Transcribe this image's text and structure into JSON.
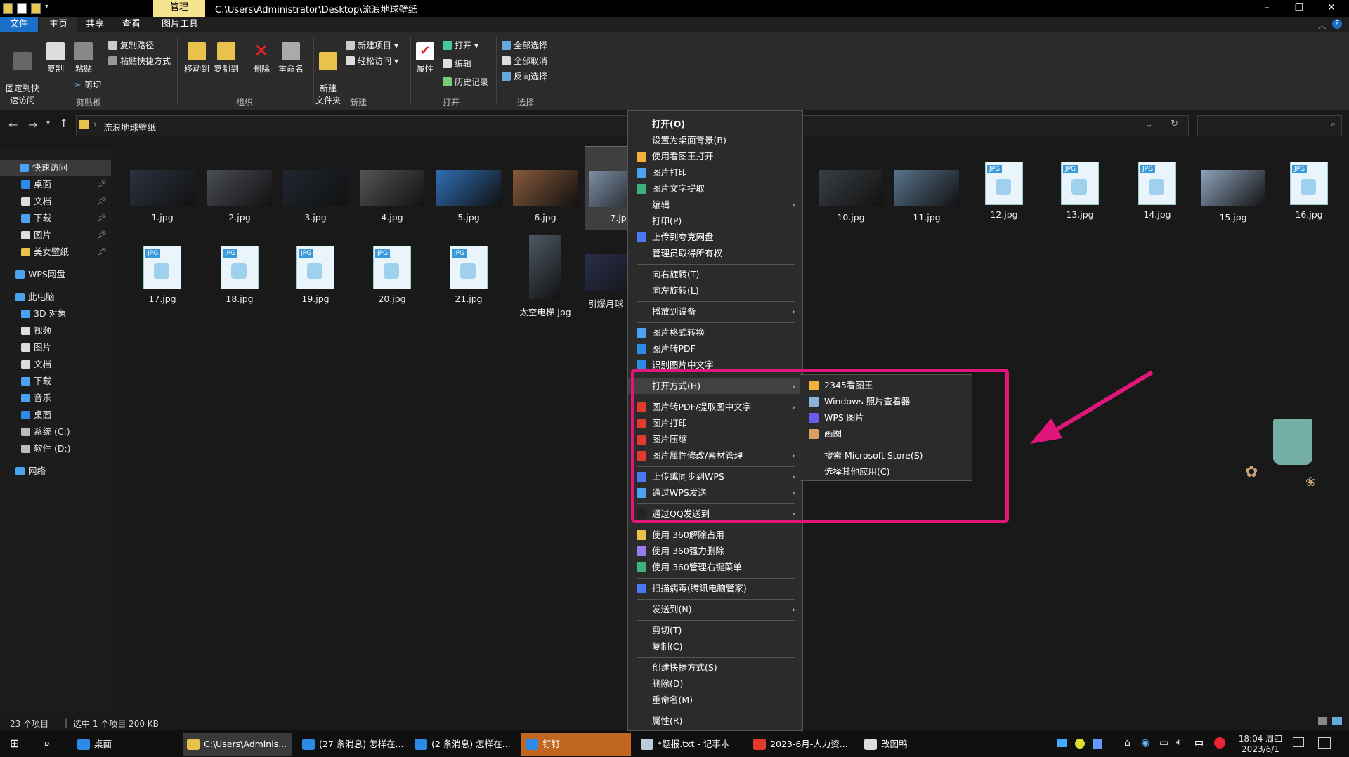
{
  "window": {
    "title_path": "C:\\Users\\Administrator\\Desktop\\流浪地球壁纸",
    "context_tab": "管理"
  },
  "ribbon_tabs": [
    "文件",
    "主页",
    "共享",
    "查看",
    "图片工具"
  ],
  "ribbon": {
    "pin_label": "固定到快\n速访问",
    "copy_label": "复制",
    "paste_label": "粘贴",
    "copy_path_label": "复制路径",
    "paste_shortcut_label": "粘贴快捷方式",
    "cut_label": "剪切",
    "move_to_label": "移动到",
    "copy_to_label": "复制到",
    "delete_label": "删除",
    "rename_label": "重命名",
    "new_folder_label": "新建\n文件夹",
    "new_item_label": "新建项目",
    "easy_access_label": "轻松访问",
    "properties_label": "属性",
    "open_label": "打开",
    "edit_label": "编辑",
    "history_label": "历史记录",
    "select_all_label": "全部选择",
    "select_none_label": "全部取消",
    "invert_label": "反向选择",
    "groups": {
      "clipboard": "剪贴板",
      "organize": "组织",
      "new": "新建",
      "open": "打开",
      "select": "选择"
    }
  },
  "address": {
    "folder": "流浪地球壁纸"
  },
  "sidebar": {
    "items": [
      {
        "label": "快速访问",
        "icon": "star-icon"
      },
      {
        "label": "桌面",
        "icon": "desktop-icon",
        "pinned": true
      },
      {
        "label": "文档",
        "icon": "document-icon",
        "pinned": true
      },
      {
        "label": "下载",
        "icon": "download-icon",
        "pinned": true
      },
      {
        "label": "图片",
        "icon": "picture-icon",
        "pinned": true
      },
      {
        "label": "美女壁纸",
        "icon": "folder-icon",
        "pinned": true
      },
      {
        "label": "WPS网盘",
        "icon": "cloud-icon"
      },
      {
        "label": "此电脑",
        "icon": "computer-icon"
      },
      {
        "label": "3D 对象",
        "icon": "cube-icon"
      },
      {
        "label": "视频",
        "icon": "video-icon"
      },
      {
        "label": "图片",
        "icon": "picture-icon"
      },
      {
        "label": "文档",
        "icon": "document-icon"
      },
      {
        "label": "下载",
        "icon": "download-icon"
      },
      {
        "label": "音乐",
        "icon": "music-icon"
      },
      {
        "label": "桌面",
        "icon": "desktop-icon"
      },
      {
        "label": "系统 (C:)",
        "icon": "drive-icon"
      },
      {
        "label": "软件 (D:)",
        "icon": "drive-icon"
      },
      {
        "label": "网络",
        "icon": "network-icon"
      }
    ]
  },
  "files": [
    {
      "name": "1.jpg",
      "kind": "photo"
    },
    {
      "name": "2.jpg",
      "kind": "photo"
    },
    {
      "name": "3.jpg",
      "kind": "photo"
    },
    {
      "name": "4.jpg",
      "kind": "photo"
    },
    {
      "name": "5.jpg",
      "kind": "photo"
    },
    {
      "name": "6.jpg",
      "kind": "photo"
    },
    {
      "name": "7.jpg",
      "kind": "photo",
      "selected": true
    },
    {
      "name": "10.jpg",
      "kind": "photo"
    },
    {
      "name": "11.jpg",
      "kind": "photo"
    },
    {
      "name": "12.jpg",
      "kind": "jpg"
    },
    {
      "name": "13.jpg",
      "kind": "jpg"
    },
    {
      "name": "14.jpg",
      "kind": "jpg"
    },
    {
      "name": "15.jpg",
      "kind": "photo"
    },
    {
      "name": "16.jpg",
      "kind": "jpg"
    },
    {
      "name": "17.jpg",
      "kind": "jpg"
    },
    {
      "name": "18.jpg",
      "kind": "jpg"
    },
    {
      "name": "19.jpg",
      "kind": "jpg"
    },
    {
      "name": "20.jpg",
      "kind": "jpg"
    },
    {
      "name": "21.jpg",
      "kind": "jpg"
    },
    {
      "name": "太空电梯.jpg",
      "kind": "photo"
    },
    {
      "name": "引爆月球",
      "kind": "photo"
    }
  ],
  "context_menu": {
    "items": [
      {
        "label": "打开(O)",
        "bold": true
      },
      {
        "label": "设置为桌面背景(B)"
      },
      {
        "label": "使用看图王打开",
        "icon": "image-viewer-icon"
      },
      {
        "label": "图片打印",
        "icon": "print-icon"
      },
      {
        "label": "图片文字提取",
        "icon": "ocr-icon"
      },
      {
        "label": "编辑",
        "arrow": true
      },
      {
        "label": "打印(P)"
      },
      {
        "label": "上传到夸克网盘",
        "icon": "quark-icon"
      },
      {
        "label": "管理员取得所有权"
      },
      {
        "sep": true
      },
      {
        "label": "向右旋转(T)"
      },
      {
        "label": "向左旋转(L)"
      },
      {
        "sep": true
      },
      {
        "label": "播放到设备",
        "arrow": true
      },
      {
        "sep": true
      },
      {
        "label": "图片格式转换",
        "icon": "convert-icon"
      },
      {
        "label": "图片转PDF",
        "icon": "pdf-icon"
      },
      {
        "label": "识别图片中文字",
        "icon": "text-recognize-icon"
      },
      {
        "sep": true
      },
      {
        "label": "打开方式(H)",
        "arrow": true,
        "highlight": true
      },
      {
        "sep": true
      },
      {
        "label": "图片转PDF/提取图中文字",
        "icon": "wps-icon",
        "arrow": true
      },
      {
        "label": "图片打印",
        "icon": "wps-icon"
      },
      {
        "label": "图片压缩",
        "icon": "wps-icon"
      },
      {
        "label": "图片属性修改/素材管理",
        "icon": "wps-icon",
        "arrow": true
      },
      {
        "sep": true
      },
      {
        "label": "上传或同步到WPS",
        "icon": "upload-icon",
        "arrow": true
      },
      {
        "label": "通过WPS发送",
        "icon": "send-icon",
        "arrow": true
      },
      {
        "sep": true
      },
      {
        "label": "通过QQ发送到",
        "icon": "qq-icon",
        "arrow": true
      },
      {
        "sep": true
      },
      {
        "label": "使用 360解除占用",
        "icon": "folder-icon"
      },
      {
        "label": "使用 360强力删除",
        "icon": "shred-icon"
      },
      {
        "label": "使用 360管理右键菜单",
        "icon": "360-icon"
      },
      {
        "sep": true
      },
      {
        "label": "扫描病毒(腾讯电脑管家)",
        "icon": "shield-icon"
      },
      {
        "sep": true
      },
      {
        "label": "发送到(N)",
        "arrow": true
      },
      {
        "sep": true
      },
      {
        "label": "剪切(T)"
      },
      {
        "label": "复制(C)"
      },
      {
        "sep": true
      },
      {
        "label": "创建快捷方式(S)"
      },
      {
        "label": "删除(D)"
      },
      {
        "label": "重命名(M)"
      },
      {
        "sep": true
      },
      {
        "label": "属性(R)"
      }
    ]
  },
  "open_with_submenu": {
    "items": [
      {
        "label": "2345看图王",
        "icon": "image-viewer-icon"
      },
      {
        "label": "Windows 照片查看器",
        "icon": "photo-viewer-icon"
      },
      {
        "label": "WPS 图片",
        "icon": "wps-picture-icon"
      },
      {
        "label": "画图",
        "icon": "paint-icon"
      },
      {
        "sep": true
      },
      {
        "label": "搜索 Microsoft Store(S)"
      },
      {
        "label": "选择其他应用(C)"
      }
    ]
  },
  "status": {
    "count": "23 个项目",
    "selected": "选中 1 个项目  200 KB"
  },
  "taskbar": {
    "items": [
      {
        "label": "桌面",
        "icon": "desktop-icon"
      },
      {
        "label": "C:\\Users\\Adminis...",
        "icon": "folder-icon"
      },
      {
        "label": "(27 条消息) 怎样在...",
        "icon": "browser-icon"
      },
      {
        "label": "(2 条消息) 怎样在...",
        "icon": "browser-icon"
      },
      {
        "label": "钉钉",
        "icon": "dingtalk-icon"
      },
      {
        "label": "*题报.txt - 记事本",
        "icon": "notepad-icon"
      },
      {
        "label": "2023-6月-人力资...",
        "icon": "wps-icon"
      },
      {
        "label": "改图鸭",
        "icon": "app-icon"
      }
    ],
    "ime": "中",
    "time": "18:04 周四",
    "date": "2023/6/1"
  },
  "colors": {
    "highlight_box": "#e0167a",
    "arrow": "#e0167a",
    "accent": "#1a6fc8"
  }
}
